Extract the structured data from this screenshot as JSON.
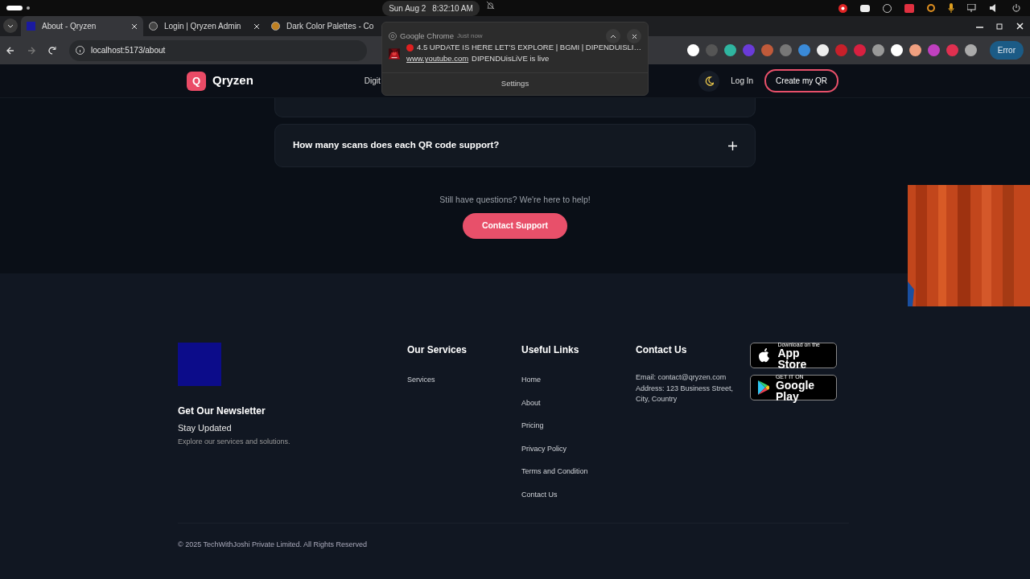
{
  "system_bar": {
    "date": "Sun Aug 2",
    "time": "8:32:10 AM"
  },
  "browser": {
    "tabs": [
      {
        "title": "About - Qryzen",
        "selected": true
      },
      {
        "title": "Login | Qryzen Admin",
        "selected": false
      },
      {
        "title": "Dark Color Palettes - Co",
        "selected": false
      }
    ],
    "address": "localhost:5173/about",
    "profile_button": "Error"
  },
  "notification": {
    "app": "Google Chrome",
    "time": "Just now",
    "title": "4.5 UPDATE IS HERE LET'S EXPLORE | BGMI | DIPENDUISLI…",
    "source": "www.youtube.com",
    "message": "DIPENDUisLiVE is live",
    "action": "Settings"
  },
  "site_header": {
    "logo_letter": "Q",
    "brand": "Qryzen",
    "nav": [
      "Digit"
    ],
    "login": "Log In",
    "cta": "Create my QR"
  },
  "faq": [
    {
      "question": "How many scans does each QR code support?",
      "expanded": false
    }
  ],
  "help_text": "Still have questions? We're here to help!",
  "contact_button": "Contact Support",
  "footer": {
    "newsletter_title": "Get Our Newsletter",
    "newsletter_subtitle": "Stay Updated",
    "newsletter_text": "Explore our services and solutions.",
    "columns": [
      {
        "heading": "Our Services",
        "links": [
          "Services"
        ]
      },
      {
        "heading": "Useful Links",
        "links": [
          "Home",
          "About",
          "Pricing",
          "Privacy Policy",
          "Terms and Condition",
          "Contact Us"
        ]
      }
    ],
    "contact": {
      "heading": "Contact Us",
      "lines": [
        "Email: contact@qryzen.com",
        "Address: 123 Business Street, City, Country"
      ]
    },
    "stores": [
      {
        "kind": "apple",
        "small": "Download on the",
        "big": "App Store"
      },
      {
        "kind": "google",
        "small": "GET IT ON",
        "big": "Google Play"
      }
    ],
    "copyright": "© 2025 TechWithJoshi Private Limited. All Rights Reserved"
  }
}
